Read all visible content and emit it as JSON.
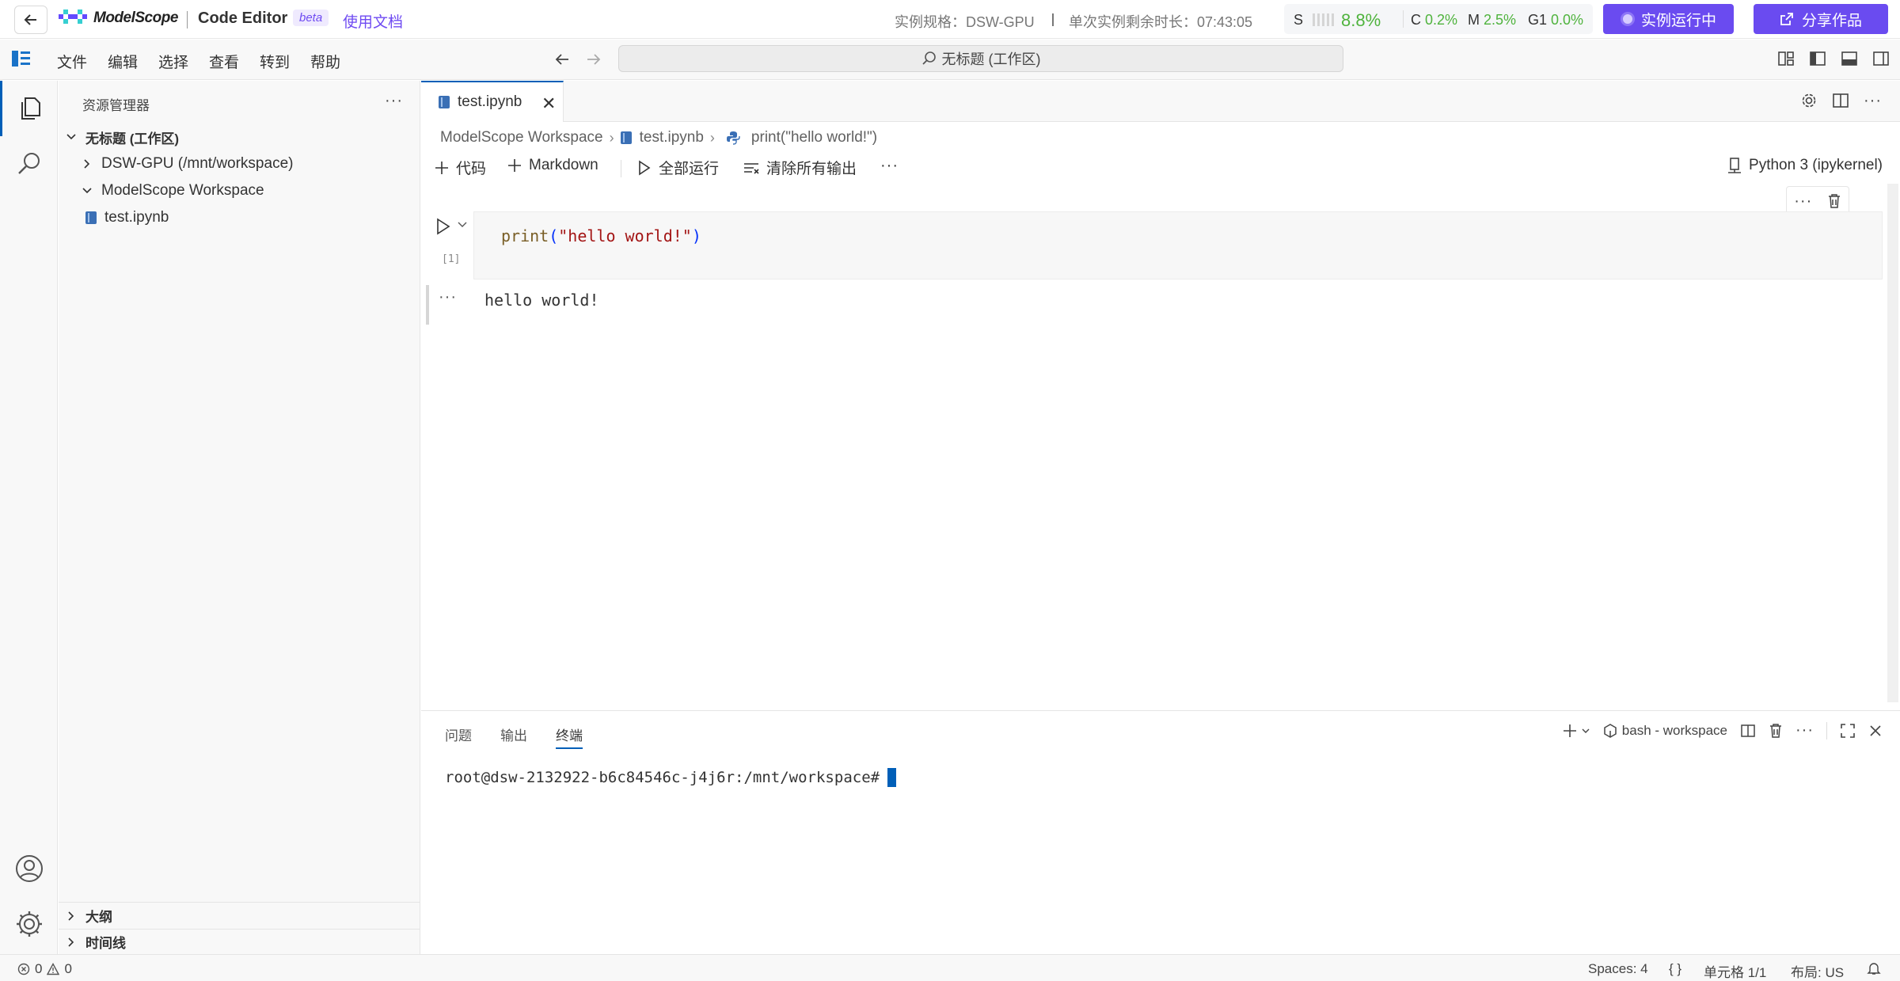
{
  "topbar": {
    "logo_text": "ModelScope",
    "product_name": "Code Editor",
    "beta": "beta",
    "docs_link": "使用文档",
    "spec_label": "实例规格：DSW-GPU",
    "remaining_label": "单次实例剩余时长：07:43:05",
    "usage": {
      "s_label": "S",
      "s_value": "8.8%",
      "c_label": "C",
      "c_value": "0.2%",
      "m_label": "M",
      "m_value": "2.5%",
      "g_label": "G1",
      "g_value": "0.0%"
    },
    "run_button": "实例运行中",
    "share_button": "分享作品"
  },
  "menubar": {
    "items": [
      "文件",
      "编辑",
      "选择",
      "查看",
      "转到",
      "帮助"
    ],
    "command_center": "无标题 (工作区)"
  },
  "sidebar": {
    "title": "资源管理器",
    "tree": {
      "root": "无标题 (工作区)",
      "folder1": "DSW-GPU (/mnt/workspace)",
      "folder2": "ModelScope Workspace",
      "file": "test.ipynb"
    },
    "outline": "大纲",
    "timeline": "时间线"
  },
  "editor": {
    "tab_label": "test.ipynb",
    "breadcrumb": [
      "ModelScope Workspace",
      "test.ipynb",
      "print(\"hello world!\")"
    ],
    "toolbar": {
      "add_code": "代码",
      "add_markdown": "Markdown",
      "run_all": "全部运行",
      "clear_outputs": "清除所有输出"
    },
    "kernel": "Python 3 (ipykernel)",
    "cell": {
      "exec_count": "[1]",
      "code_fn": "print",
      "code_open": "(",
      "code_str": "\"hello world!\"",
      "code_close": ")"
    },
    "output": "hello world!"
  },
  "panel": {
    "tabs": [
      "问题",
      "输出",
      "终端"
    ],
    "terminal_name": "bash - workspace",
    "prompt": "root@dsw-2132922-b6c84546c-j4j6r:/mnt/workspace#"
  },
  "statusbar": {
    "errors": "0",
    "warnings": "0",
    "spaces": "Spaces: 4",
    "braces": "{ }",
    "cell": "单元格 1/1",
    "layout": "布局: US"
  },
  "colors": {
    "accent": "#6a4bf0",
    "focus_blue": "#005fb8",
    "usage_green": "#4fb33d"
  }
}
